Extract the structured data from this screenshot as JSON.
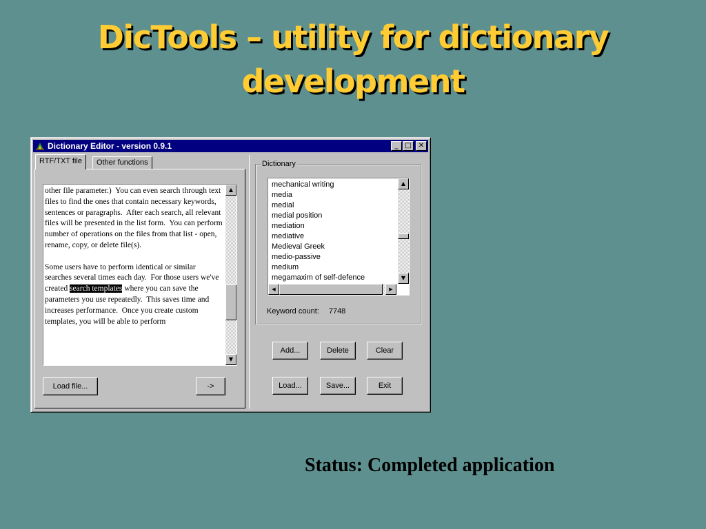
{
  "slide": {
    "title_line1": "DicTools – utility for dictionary",
    "title_line2": "development",
    "status": "Status: Completed application"
  },
  "window": {
    "title": "Dictionary Editor - version 0.9.1",
    "minimize_glyph": "_",
    "maximize_glyph": "□",
    "close_glyph": "✕"
  },
  "tabs": [
    {
      "label": "RTF/TXT file",
      "active": true
    },
    {
      "label": "Other functions",
      "active": false
    }
  ],
  "text_panel": {
    "paragraph1": "other file parameter.)  You can even search through text files to find the ones that contain necessary keywords, sentences or paragraphs.  After each search, all relevant files will be presented in the list form.  You can perform number of operations on the files from that list - open, rename, copy, or delete file(s).",
    "paragraph2_before": "Some users have to perform identical or similar searches several times each day.  For those users we've created ",
    "highlight": "search templates",
    "paragraph2_after": " where you can save the parameters you use repeatedly.  This saves time and increases performance.  Once you create custom templates, you will be able to perform",
    "load_button": "Load file...",
    "arrow_button": "->"
  },
  "dictionary": {
    "group_label": "Dictionary",
    "items": [
      "mechanical writing",
      "media",
      "medial",
      "medial position",
      "mediation",
      "mediative",
      "Medieval Greek",
      "medio-passive",
      "medium",
      "megamaxim of self-defence"
    ],
    "keyword_label": "Keyword count:",
    "keyword_count": "7748"
  },
  "buttons": {
    "add": "Add...",
    "delete": "Delete",
    "clear": "Clear",
    "load": "Load...",
    "save": "Save...",
    "exit": "Exit"
  },
  "colors": {
    "slide_background": "#5f9090",
    "title_text": "#ffcc33",
    "titlebar": "#000080",
    "window_face": "#c0c0c0"
  }
}
